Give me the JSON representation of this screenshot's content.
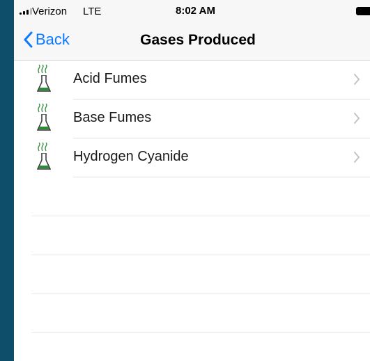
{
  "status_bar": {
    "carrier": "Verizon",
    "network": "LTE",
    "time": "8:02 AM"
  },
  "nav": {
    "back_label": "Back",
    "title": "Gases Produced"
  },
  "list": {
    "items": [
      {
        "label": "Acid Fumes",
        "icon": "fuming-flask-icon"
      },
      {
        "label": "Base Fumes",
        "icon": "fuming-flask-icon"
      },
      {
        "label": "Hydrogen Cyanide",
        "icon": "fuming-flask-icon"
      }
    ]
  },
  "colors": {
    "ios_blue": "#0a7aff",
    "flask_green": "#2e8b3a",
    "background": "#0f4e6b"
  }
}
